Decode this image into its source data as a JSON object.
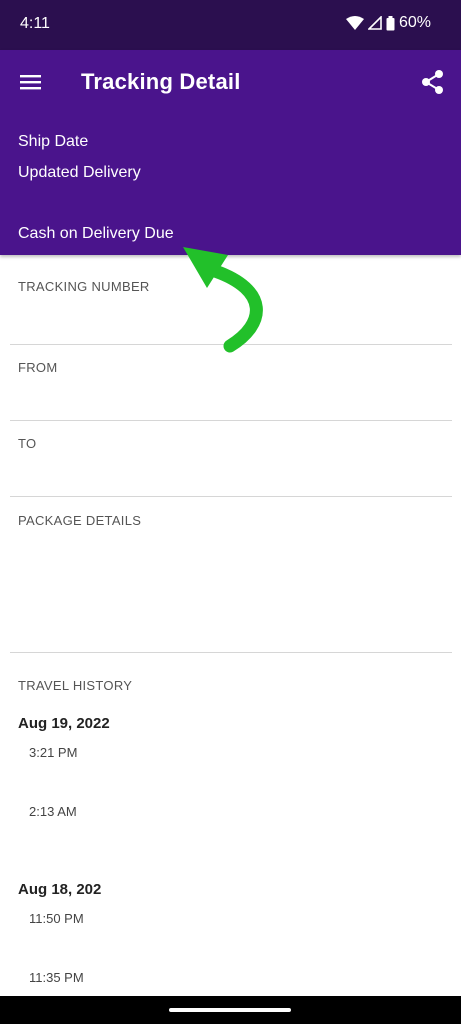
{
  "status_bar": {
    "time": "4:11",
    "battery": "60%"
  },
  "app_bar": {
    "title": "Tracking Detail"
  },
  "header_fields": {
    "ship_date": "Ship Date",
    "updated_delivery": "Updated Delivery",
    "cod_due": "Cash on Delivery Due"
  },
  "sections": {
    "tracking_number": "TRACKING NUMBER",
    "from": "FROM",
    "to": "TO",
    "package_details": "PACKAGE DETAILS",
    "travel_history": "TRAVEL HISTORY"
  },
  "travel_history": [
    {
      "date": "Aug 19, 2022",
      "times": [
        "3:21 PM",
        "2:13 AM"
      ]
    },
    {
      "date": "Aug 18, 202",
      "times": [
        "11:50 PM",
        "11:35 PM"
      ]
    }
  ],
  "colors": {
    "status_bar": "#2b0f4f",
    "app_bar": "#4a148c",
    "arrow": "#22c02a"
  },
  "icons": [
    "menu-icon",
    "share-icon",
    "wifi-icon",
    "signal-icon",
    "battery-icon"
  ]
}
